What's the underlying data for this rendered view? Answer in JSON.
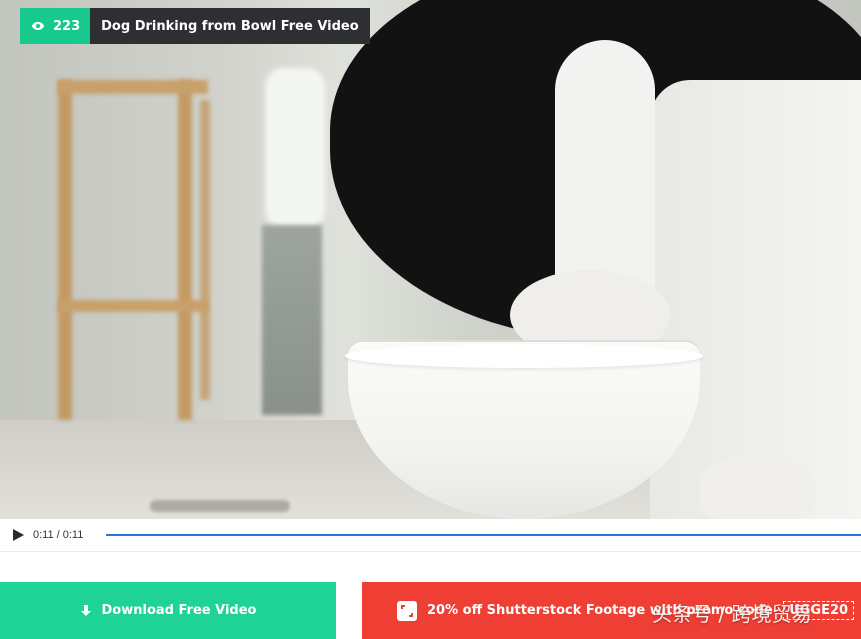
{
  "header": {
    "views": "223",
    "title": "Dog Drinking from Bowl Free Video",
    "views_icon": "eye-icon"
  },
  "player": {
    "time": "0:11 / 0:11",
    "progress": 1.0,
    "play_icon": "play-icon"
  },
  "actions": {
    "download_label": "Download Free Video",
    "download_icon": "download-arrow-icon",
    "promo_label": "20% off Shutterstock Footage with promo code",
    "promo_code": "UGGE20",
    "promo_icon": "shutterstock-icon"
  },
  "watermark": "头条号 / 跨境贸易",
  "colors": {
    "green": "#1fd396",
    "red": "#ef3f34",
    "title_bg": "#2d2f33",
    "progress": "#2d6fe0"
  }
}
